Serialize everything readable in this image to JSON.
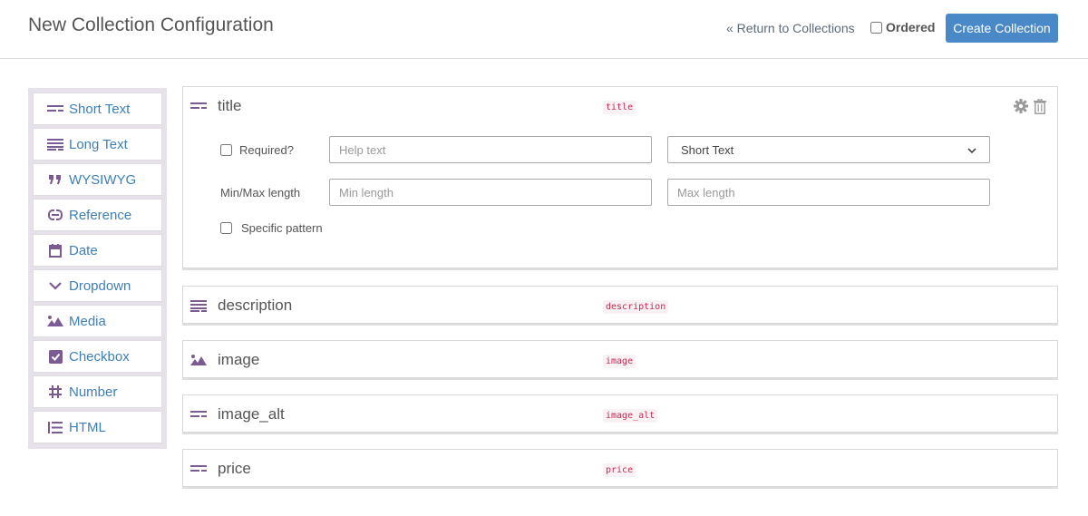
{
  "header": {
    "title": "New Collection Configuration",
    "return_link": "« Return to Collections",
    "ordered_label": "Ordered",
    "create_button": "Create Collection"
  },
  "sidebar": {
    "items": [
      {
        "label": "Short Text",
        "icon": "short-text-icon"
      },
      {
        "label": "Long Text",
        "icon": "long-text-icon"
      },
      {
        "label": "WYSIWYG",
        "icon": "quote-icon"
      },
      {
        "label": "Reference",
        "icon": "link-icon"
      },
      {
        "label": "Date",
        "icon": "calendar-icon"
      },
      {
        "label": "Dropdown",
        "icon": "chevron-down-icon"
      },
      {
        "label": "Media",
        "icon": "image-icon"
      },
      {
        "label": "Checkbox",
        "icon": "checkbox-icon"
      },
      {
        "label": "Number",
        "icon": "hash-icon"
      },
      {
        "label": "HTML",
        "icon": "list-icon"
      }
    ]
  },
  "fields": [
    {
      "name": "title",
      "tag": "title",
      "icon": "short-text-icon",
      "expanded": true,
      "required_label": "Required?",
      "help_placeholder": "Help text",
      "type_value": "Short Text",
      "minmax_label": "Min/Max length",
      "min_placeholder": "Min length",
      "max_placeholder": "Max length",
      "pattern_label": "Specific pattern"
    },
    {
      "name": "description",
      "tag": "description",
      "icon": "long-text-icon"
    },
    {
      "name": "image",
      "tag": "image",
      "icon": "image-icon"
    },
    {
      "name": "image_alt",
      "tag": "image_alt",
      "icon": "short-text-icon"
    },
    {
      "name": "price",
      "tag": "price",
      "icon": "short-text-icon"
    }
  ],
  "colors": {
    "accent": "#4a89c8",
    "link": "#3e7fb8",
    "icon_purple": "#7a5b94",
    "tag_red": "#c7254e"
  }
}
